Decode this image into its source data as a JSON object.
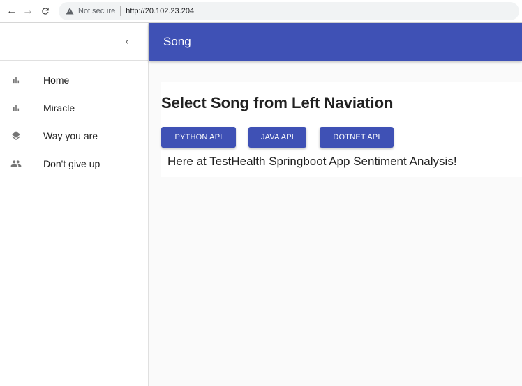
{
  "browser": {
    "security_label": "Not secure",
    "url": "http://20.102.23.204"
  },
  "appbar": {
    "title": "Song"
  },
  "sidebar": {
    "items": [
      {
        "label": "Home",
        "icon": "bar-chart-icon"
      },
      {
        "label": "Miracle",
        "icon": "bar-chart-icon"
      },
      {
        "label": "Way you are",
        "icon": "layers-icon"
      },
      {
        "label": "Don't give up",
        "icon": "people-icon"
      }
    ]
  },
  "main": {
    "heading": "Select Song from Left Naviation",
    "buttons": {
      "python": "PYTHON API",
      "java": "JAVA API",
      "dotnet": "DOTNET API"
    },
    "message": "Here at TestHealth Springboot App Sentiment Analysis!"
  },
  "colors": {
    "primary": "#3f51b5",
    "icon_gray": "#757575"
  }
}
